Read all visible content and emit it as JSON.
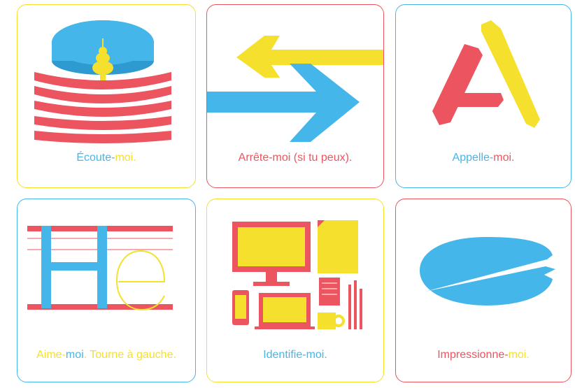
{
  "colors": {
    "blue": "#45b6ea",
    "yellow": "#f5e02e",
    "red": "#ec5560"
  },
  "cards": [
    {
      "border": "yellow",
      "icon": "bell-hat-icon",
      "parts": [
        "Écoute",
        "-",
        "moi."
      ],
      "partColors": [
        "blue",
        "blue",
        "yellow"
      ]
    },
    {
      "border": "red",
      "icon": "arrows-icon",
      "parts": [
        "Arrête",
        "-",
        "moi",
        " (si tu peux)."
      ],
      "partColors": [
        "red",
        "red",
        "red",
        "red"
      ]
    },
    {
      "border": "blue",
      "icon": "letter-a-icon",
      "parts": [
        "Appelle",
        "-",
        "moi."
      ],
      "partColors": [
        "blue",
        "blue",
        "red"
      ]
    },
    {
      "border": "blue",
      "icon": "typography-he-icon",
      "parts": [
        "Aime",
        "-",
        "moi",
        ". Tourne à gauche."
      ],
      "partColors": [
        "yellow",
        "yellow",
        "blue",
        "yellow"
      ]
    },
    {
      "border": "yellow",
      "icon": "devices-stationery-icon",
      "parts": [
        "Identifie",
        "-",
        "moi."
      ],
      "partColors": [
        "blue",
        "blue",
        "blue"
      ]
    },
    {
      "border": "red",
      "icon": "blue-ellipse-icon",
      "parts": [
        "Impressionne",
        "-",
        "moi."
      ],
      "partColors": [
        "red",
        "red",
        "yellow"
      ]
    }
  ]
}
